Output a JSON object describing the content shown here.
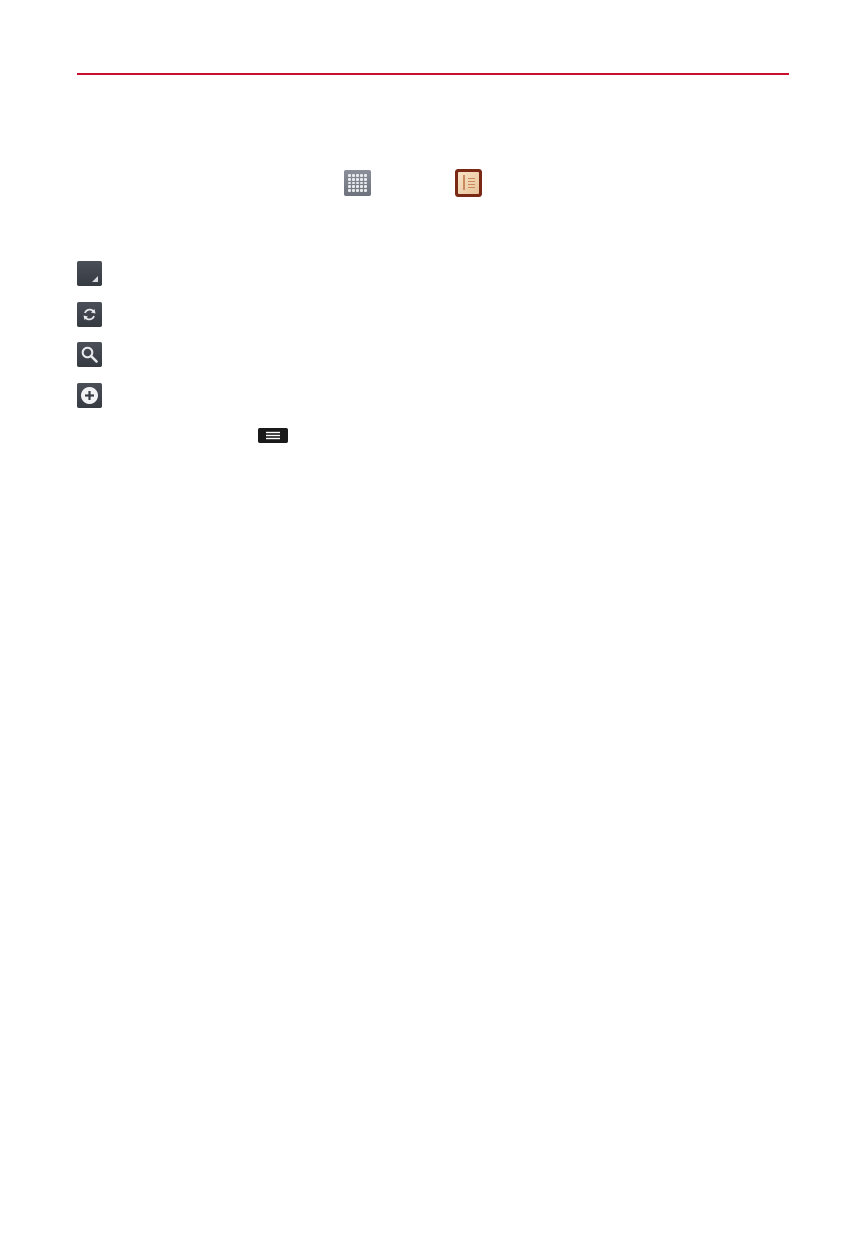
{
  "page": {
    "accent_color": "#c8102e"
  },
  "icons": {
    "apps": "apps-grid-icon",
    "memo_app": "notebook-app-icon",
    "actions": [
      "resize-corner-icon",
      "sync-icon",
      "search-icon",
      "add-icon"
    ],
    "menu_key": "menu-key-icon"
  }
}
